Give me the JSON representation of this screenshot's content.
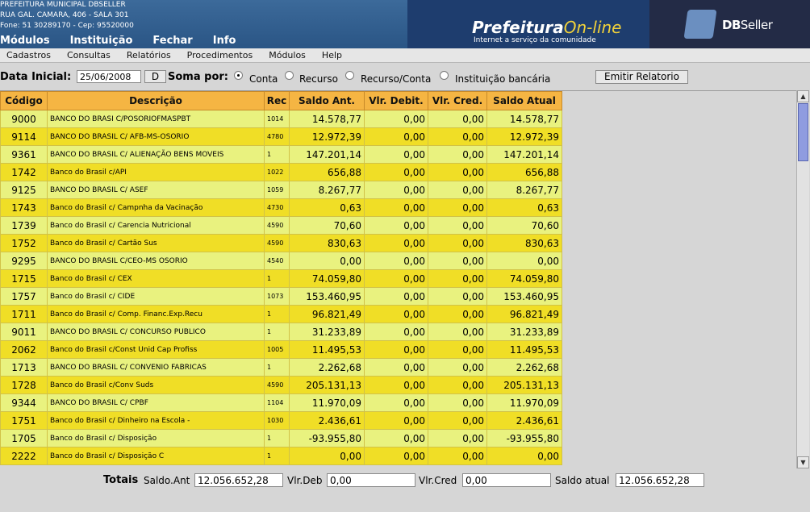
{
  "header": {
    "org_name": "PREFEITURA MUNICIPAL DBSELLER",
    "address": "RUA GAL. CAMARA, 406 - SALA 301",
    "phone": "Fone: 51 30289170  -  Cep: 95520000",
    "brand_title_a": "Prefeitura",
    "brand_title_b": "On-line",
    "brand_tagline": "Internet a serviço da comunidade",
    "dbseller_a": "DB",
    "dbseller_b": "Seller"
  },
  "top_menu": [
    "Módulos",
    "Instituição",
    "Fechar",
    "Info"
  ],
  "sub_menu": [
    "Cadastros",
    "Consultas",
    "Relatórios",
    "Procedimentos",
    "Módulos",
    "Help"
  ],
  "filters": {
    "data_inicial_label": "Data Inicial:",
    "data_inicial_value": "25/06/2008",
    "d_button": "D",
    "soma_por_label": "Soma por:",
    "options": [
      "Conta",
      "Recurso",
      "Recurso/Conta",
      "Instituição bancária"
    ],
    "selected": "Conta",
    "emitir_button": "Emitir Relatorio"
  },
  "table": {
    "columns": [
      "Código",
      "Descrição",
      "Rec",
      "Saldo Ant.",
      "Vlr. Debit.",
      "Vlr. Cred.",
      "Saldo Atual"
    ],
    "rows": [
      [
        "9000",
        "BANCO DO BRASI C/POSORIOFMASPBT",
        "1014",
        "14.578,77",
        "0,00",
        "0,00",
        "14.578,77"
      ],
      [
        "9114",
        "BANCO DO BRASIL C/ AFB-MS-OSORIO",
        "4780",
        "12.972,39",
        "0,00",
        "0,00",
        "12.972,39"
      ],
      [
        "9361",
        "BANCO DO BRASIL C/ ALIENAÇÃO BENS MOVEIS",
        "1",
        "147.201,14",
        "0,00",
        "0,00",
        "147.201,14"
      ],
      [
        "1742",
        "Banco do Brasil c/API",
        "1022",
        "656,88",
        "0,00",
        "0,00",
        "656,88"
      ],
      [
        "9125",
        "BANCO DO BRASIL C/ ASEF",
        "1059",
        "8.267,77",
        "0,00",
        "0,00",
        "8.267,77"
      ],
      [
        "1743",
        "Banco do Brasil c/ Campnha da Vacinação",
        "4730",
        "0,63",
        "0,00",
        "0,00",
        "0,63"
      ],
      [
        "1739",
        "Banco do Brasil c/ Carencia Nutricional",
        "4590",
        "70,60",
        "0,00",
        "0,00",
        "70,60"
      ],
      [
        "1752",
        "Banco do Brasil c/ Cartão Sus",
        "4590",
        "830,63",
        "0,00",
        "0,00",
        "830,63"
      ],
      [
        "9295",
        "BANCO DO BRASIL C/CEO-MS OSORIO",
        "4540",
        "0,00",
        "0,00",
        "0,00",
        "0,00"
      ],
      [
        "1715",
        "Banco do Brasil c/ CEX",
        "1",
        "74.059,80",
        "0,00",
        "0,00",
        "74.059,80"
      ],
      [
        "1757",
        "Banco do Brasil c/ CIDE",
        "1073",
        "153.460,95",
        "0,00",
        "0,00",
        "153.460,95"
      ],
      [
        "1711",
        "Banco do Brasil c/ Comp. Financ.Exp.Recu",
        "1",
        "96.821,49",
        "0,00",
        "0,00",
        "96.821,49"
      ],
      [
        "9011",
        "BANCO DO BRASIL C/ CONCURSO PUBLICO",
        "1",
        "31.233,89",
        "0,00",
        "0,00",
        "31.233,89"
      ],
      [
        "2062",
        "Banco do Brasil c/Const Unid Cap Profiss",
        "1005",
        "11.495,53",
        "0,00",
        "0,00",
        "11.495,53"
      ],
      [
        "1713",
        "BANCO DO BRASIL C/ CONVENIO FABRICAS",
        "1",
        "2.262,68",
        "0,00",
        "0,00",
        "2.262,68"
      ],
      [
        "1728",
        "Banco do Brasil c/Conv Suds",
        "4590",
        "205.131,13",
        "0,00",
        "0,00",
        "205.131,13"
      ],
      [
        "9344",
        "BANCO DO BRASIL C/ CPBF",
        "1104",
        "11.970,09",
        "0,00",
        "0,00",
        "11.970,09"
      ],
      [
        "1751",
        "Banco do Brasil c/ Dinheiro na Escola -",
        "1030",
        "2.436,61",
        "0,00",
        "0,00",
        "2.436,61"
      ],
      [
        "1705",
        "Banco do Brasil c/ Disposição",
        "1",
        "-93.955,80",
        "0,00",
        "0,00",
        "-93.955,80"
      ],
      [
        "2222",
        "Banco do Brasil c/ Disposição C",
        "1",
        "0,00",
        "0,00",
        "0,00",
        "0,00"
      ]
    ]
  },
  "totals": {
    "label": "Totais",
    "saldo_ant_label": "Saldo.Ant",
    "saldo_ant_value": "12.056.652,28",
    "vlr_deb_label": "Vlr.Deb",
    "vlr_deb_value": "0,00",
    "vlr_cred_label": "Vlr.Cred",
    "vlr_cred_value": "0,00",
    "saldo_atual_label": "Saldo atual",
    "saldo_atual_value": "12.056.652,28"
  },
  "colors": {
    "header_bg": "#2a5585",
    "table_header": "#f5b543",
    "row_light": "#e9f27f",
    "row_dark": "#f0de26",
    "scroll_thumb": "#8f9ce0"
  }
}
